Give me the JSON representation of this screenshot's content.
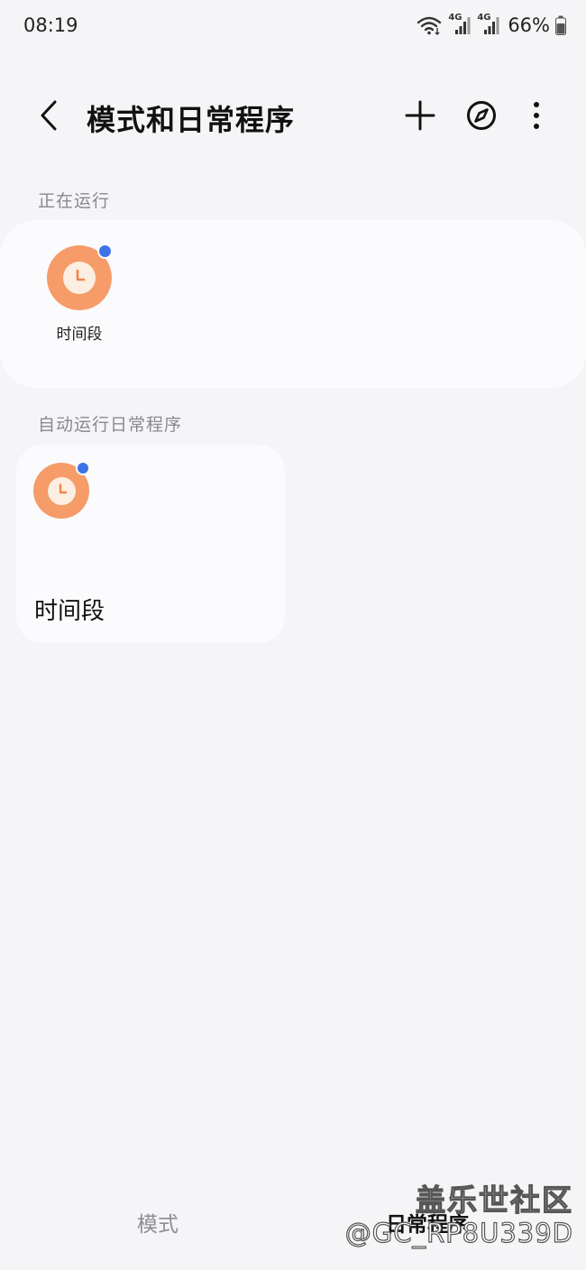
{
  "status_bar": {
    "time": "08:19",
    "network_1": "4G",
    "network_2": "4G",
    "battery": "66%"
  },
  "header": {
    "title": "模式和日常程序",
    "icons": [
      "back-icon",
      "plus-icon",
      "compass-icon",
      "more-vert-icon"
    ]
  },
  "running": {
    "section_label": "正在运行",
    "items": [
      {
        "label": "时间段",
        "icon": "clock-icon",
        "active": true
      }
    ]
  },
  "auto_routines": {
    "section_label": "自动运行日常程序",
    "items": [
      {
        "label": "时间段",
        "icon": "clock-icon",
        "active": true
      }
    ]
  },
  "bottom_nav": {
    "tabs": [
      {
        "label": "模式",
        "selected": false
      },
      {
        "label": "日常程序",
        "selected": true
      }
    ]
  },
  "watermark": {
    "line1": "盖乐世社区",
    "line2": "@GC_RP8U339D"
  },
  "colors": {
    "background": "#f5f5f8",
    "card": "#fbfbfe",
    "icon_orange": "#f59c69",
    "active_dot": "#3e74e6",
    "section_label": "#8a8a8e"
  }
}
